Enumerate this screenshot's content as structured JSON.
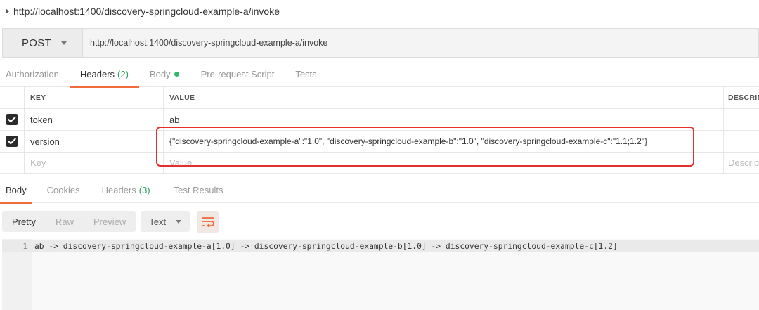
{
  "request_title": "http://localhost:1400/discovery-springcloud-example-a/invoke",
  "request_bar": {
    "method": "POST",
    "url": "http://localhost:1400/discovery-springcloud-example-a/invoke"
  },
  "request_tabs": {
    "authorization": "Authorization",
    "headers": "Headers",
    "headers_count": "(2)",
    "body": "Body",
    "pre_request": "Pre-request Script",
    "tests": "Tests"
  },
  "headers_table": {
    "col_key": "KEY",
    "col_value": "VALUE",
    "col_desc": "DESCRIPT",
    "rows": [
      {
        "key": "token",
        "value": "ab"
      },
      {
        "key": "version",
        "value": "{\"discovery-springcloud-example-a\":\"1.0\", \"discovery-springcloud-example-b\":\"1.0\", \"discovery-springcloud-example-c\":\"1.1;1.2\"}"
      }
    ],
    "placeholder_key": "Key",
    "placeholder_value": "Value",
    "placeholder_desc": "Descrip"
  },
  "response_tabs": {
    "body": "Body",
    "cookies": "Cookies",
    "headers": "Headers",
    "headers_count": "(3)",
    "test_results": "Test Results"
  },
  "view_modes": {
    "pretty": "Pretty",
    "raw": "Raw",
    "preview": "Preview",
    "type": "Text"
  },
  "response_body": {
    "line_number": "1",
    "content": "ab -> discovery-springcloud-example-a[1.0] -> discovery-springcloud-example-b[1.0] -> discovery-springcloud-example-c[1.2]"
  },
  "icons": {
    "caret": "caret-right-icon",
    "wrap": "wrap-lines-icon"
  },
  "colors": {
    "accent": "#f26b3a",
    "success": "#2fb969",
    "highlight": "#e3302c"
  }
}
